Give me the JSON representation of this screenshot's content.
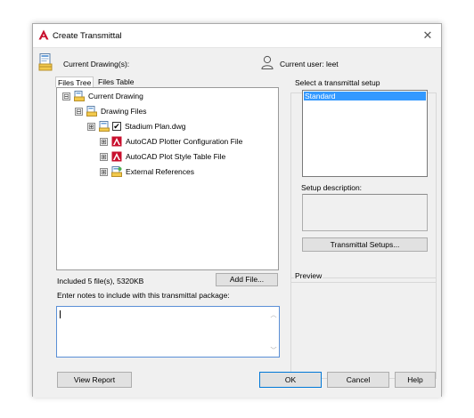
{
  "window": {
    "title": "Create Transmittal",
    "close_glyph": "✕",
    "logo_icon": "autocad-logo-icon"
  },
  "header": {
    "current_drawings_label": "Current Drawing(s):",
    "current_user_label": "Current user: leet"
  },
  "tabs": [
    "Files Tree",
    "Files Table"
  ],
  "tree": {
    "items": [
      {
        "label": "Current Drawing",
        "expander": "⊟",
        "icon": "drawing-set-icon"
      },
      {
        "label": "Drawing Files",
        "expander": "⊟",
        "icon": "drawing-files-icon"
      },
      {
        "label": "Stadium Plan.dwg",
        "expander": "⊞",
        "icon": "dwg-file-icon",
        "checked": true
      },
      {
        "label": "AutoCAD Plotter Configuration File",
        "expander": "⊞",
        "icon": "autocad-file-icon"
      },
      {
        "label": "AutoCAD Plot Style Table File",
        "expander": "⊞",
        "icon": "autocad-file-icon"
      },
      {
        "label": "External References",
        "expander": "⊞",
        "icon": "xref-icon"
      }
    ]
  },
  "summary_text": "Included 5 file(s), 5320KB",
  "add_file_label": "Add File...",
  "notes": {
    "label": "Enter notes to include with this transmittal package:",
    "value": ""
  },
  "setup": {
    "label": "Select a transmittal setup",
    "items": [
      "Standard"
    ],
    "selected": "Standard",
    "description_label": "Setup description:",
    "setups_button": "Transmittal Setups..."
  },
  "preview_label": "Preview",
  "footer": {
    "view_report": "View Report",
    "ok": "OK",
    "cancel": "Cancel",
    "help": "Help"
  },
  "colors": {
    "selection": "#3399ff",
    "focus_border": "#5a8fd6",
    "autocad_red": "#c8102e"
  }
}
